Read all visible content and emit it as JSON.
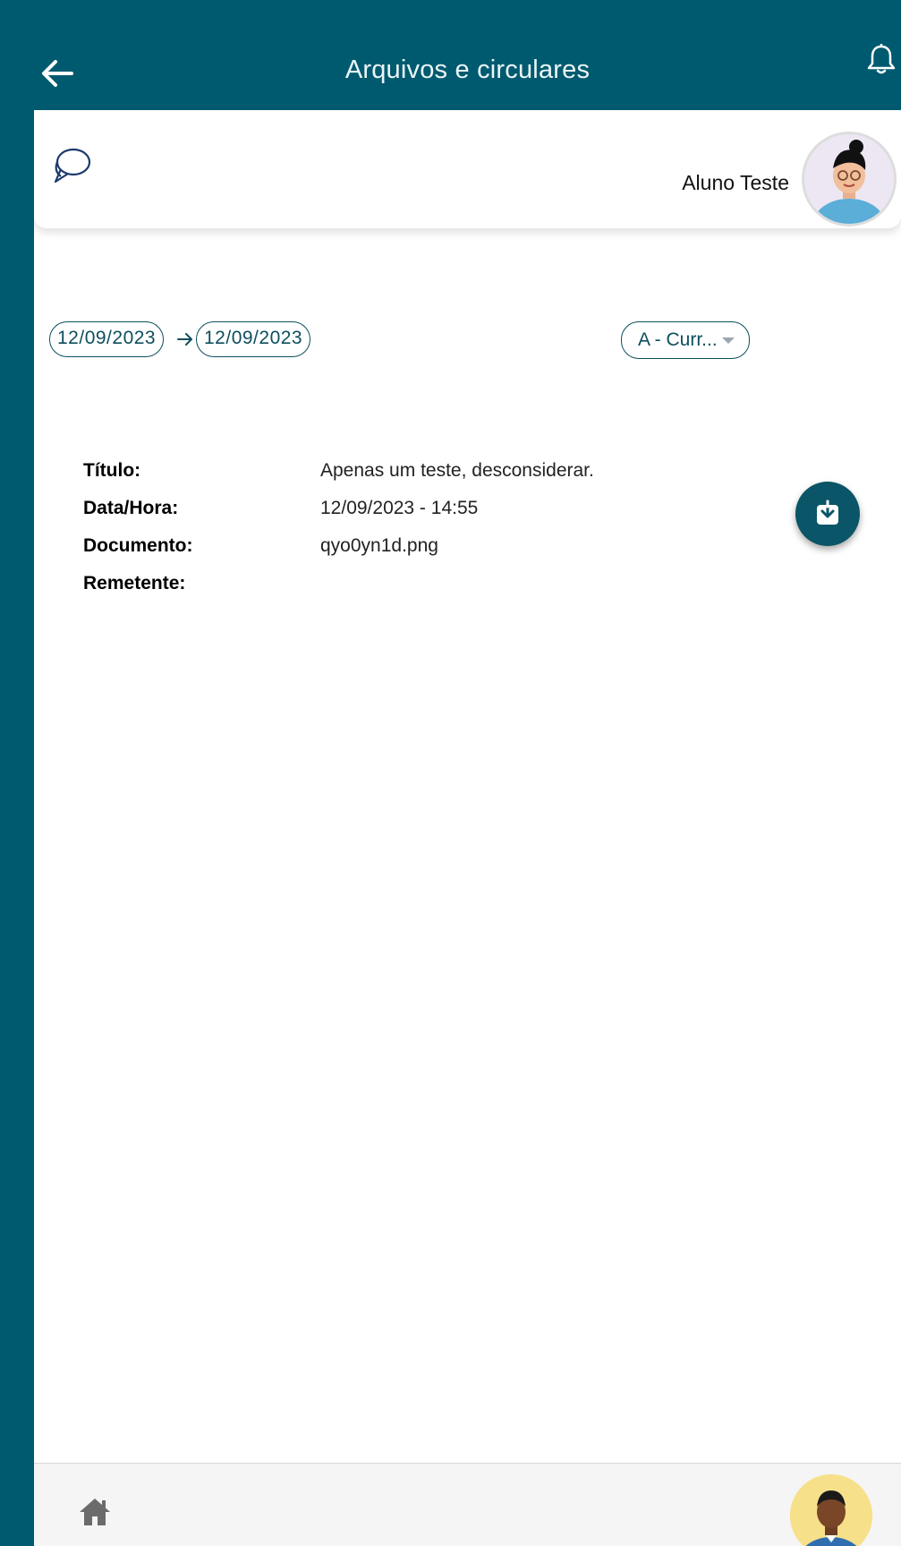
{
  "header": {
    "title": "Arquivos e circulares",
    "back_icon": "arrow-left-icon",
    "bell_icon": "bell-icon"
  },
  "profile": {
    "chat_icon": "chat-bubbles-icon",
    "student_name": "Aluno Teste",
    "avatar": "student-avatar"
  },
  "filters": {
    "date_from": "12/09/2023",
    "date_to": "12/09/2023",
    "class_selected": "A - Curr..."
  },
  "document": {
    "labels": {
      "title": "Título:",
      "datetime": "Data/Hora:",
      "document": "Documento:",
      "sender": "Remetente:"
    },
    "values": {
      "title": "Apenas um teste, desconsiderar.",
      "datetime": "12/09/2023 - 14:55",
      "document": "qyo0yn1d.png",
      "sender": ""
    },
    "download_icon": "download-icon"
  },
  "bottom_nav": {
    "home_icon": "home-icon",
    "user_avatar": "user-avatar"
  },
  "colors": {
    "primary": "#005a6f",
    "accent": "#0a5567",
    "background": "#ffffff"
  }
}
